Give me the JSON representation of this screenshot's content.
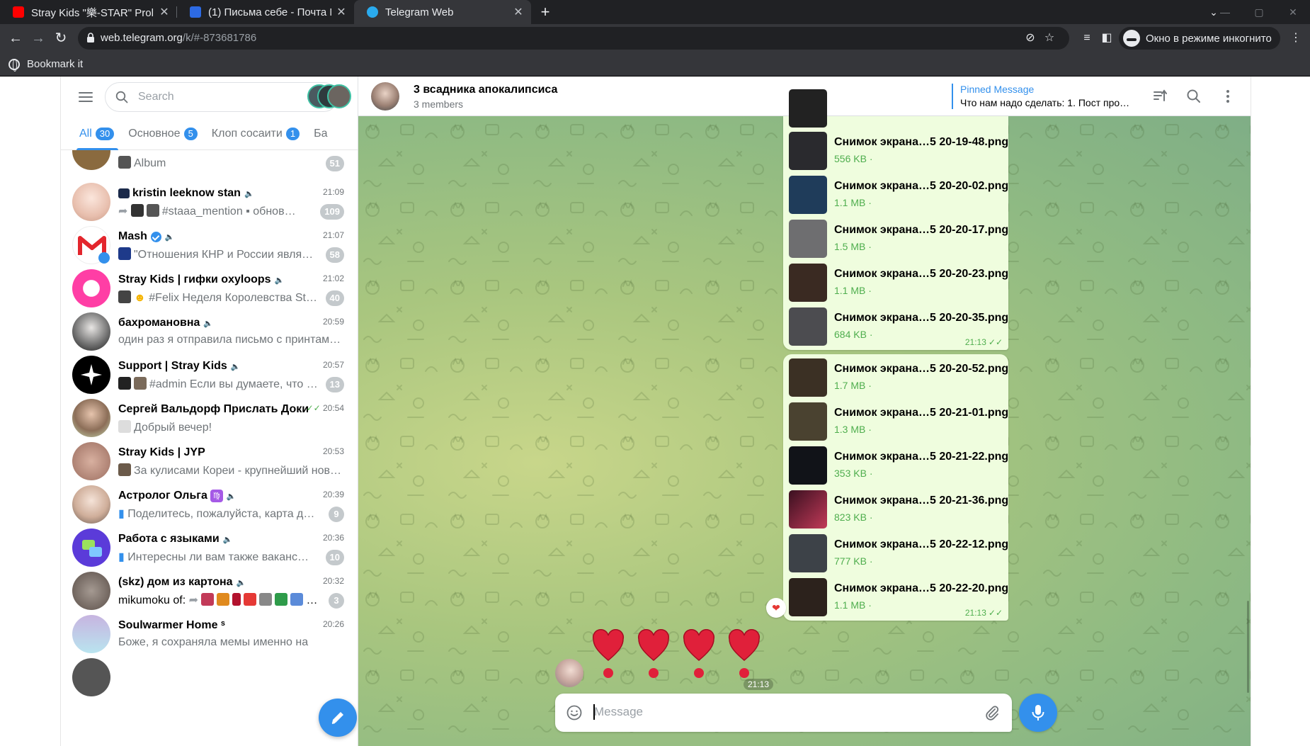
{
  "browser": {
    "tabs": [
      {
        "title": "Stray Kids \"樂-STAR\" Prol",
        "favicon_color": "#ff0000",
        "active": false
      },
      {
        "title": "(1) Письма себе - Почта M",
        "favicon_color": "#2d6ae3",
        "active": false
      },
      {
        "title": "Telegram Web",
        "favicon_color": "#2aabee",
        "active": true
      }
    ],
    "url_host": "web.telegram.org",
    "url_path": "/k/#-873681786",
    "incognito_label": "Окно в режиме инкогнито",
    "bookmark_label": "Bookmark it"
  },
  "sidebar": {
    "search_placeholder": "Search",
    "filter_tabs": [
      {
        "label": "All",
        "count": "30"
      },
      {
        "label": "Основное",
        "count": "5"
      },
      {
        "label": "Клоп сосаити",
        "count": "1"
      },
      {
        "label": "Ба",
        "count": ""
      }
    ],
    "chats": [
      {
        "name": "",
        "time": "",
        "message": "Album",
        "count": "51",
        "avatar": "#8a6a3f"
      },
      {
        "name": "kristin leeknow stan",
        "time": "21:09",
        "message": "#staaa_mention ▪ обнов…",
        "count": "109",
        "avatar": "#f2d2c9"
      },
      {
        "name": "Mash",
        "time": "21:07",
        "message": "\"Отношения КНР и России явля…",
        "count": "58",
        "avatar": "#ffffff"
      },
      {
        "name": "Stray Kids | гифки oxyloops",
        "time": "21:02",
        "message": "#Felix Неделя Королевства St…",
        "count": "40",
        "avatar": "#ff3ea5"
      },
      {
        "name": "бахромановна",
        "time": "20:59",
        "message": "один раз я отправила письмо с принтам…",
        "count": "",
        "avatar": "#3b3b3b"
      },
      {
        "name": "Support | Stray Kids",
        "time": "20:57",
        "message": "#admin Если вы думаете, что …",
        "count": "13",
        "avatar": "#000000"
      },
      {
        "name": "Сергей Вальдорф Прислать Доки",
        "time": "20:54",
        "message": "Добрый вечер!",
        "count": "",
        "avatar": "#8c7b6a"
      },
      {
        "name": "Stray Kids | JYP",
        "time": "20:53",
        "message": "За кулисами Кореи - крупнейший нов…",
        "count": "",
        "avatar": "#c9998a"
      },
      {
        "name": "Астролог Ольга",
        "time": "20:39",
        "message": "Поделитесь, пожалуйста, карта д…",
        "count": "9",
        "avatar": "#d9c2b4"
      },
      {
        "name": "Работа с языками",
        "time": "20:36",
        "message": "Интересны ли вам также ваканс…",
        "count": "10",
        "avatar": "#5b3bd9"
      },
      {
        "name": "(skz) дом из картона",
        "time": "20:32",
        "message": "mikumoku of:",
        "count": "3",
        "avatar": "#7c6b66"
      },
      {
        "name": "Soulwarmer Home ˢ",
        "time": "20:26",
        "message": "Боже, я сохраняла мемы именно на",
        "count": "",
        "avatar": "#b9e4ef"
      }
    ]
  },
  "chat": {
    "title": "3 всадника апокалипсиса",
    "subtitle": "3 members",
    "pinned_title": "Pinned Message",
    "pinned_text": "Что нам надо сделать: 1. Пост про…",
    "groups": [
      {
        "time": "21:13",
        "files": [
          {
            "name": "Снимок экрана…5 20-19-48.png",
            "size": "556 KB ·",
            "thumb": "#2a2a2e"
          },
          {
            "name": "Снимок экрана…5 20-20-02.png",
            "size": "1.1 MB ·",
            "thumb": "#1f3c5a"
          },
          {
            "name": "Снимок экрана…5 20-20-17.png",
            "size": "1.5 MB ·",
            "thumb": "#6e6e70"
          },
          {
            "name": "Снимок экрана…5 20-20-23.png",
            "size": "1.1 MB ·",
            "thumb": "#3a2a22"
          },
          {
            "name": "Снимок экрана…5 20-20-35.png",
            "size": "684 KB ·",
            "thumb": "#4c4c50"
          }
        ]
      },
      {
        "time": "21:13",
        "files": [
          {
            "name": "Снимок экрана…5 20-20-52.png",
            "size": "1.7 MB ·",
            "thumb": "#3b3024"
          },
          {
            "name": "Снимок экрана…5 20-21-01.png",
            "size": "1.3 MB ·",
            "thumb": "#4a4230"
          },
          {
            "name": "Снимок экрана…5 20-21-22.png",
            "size": "353 KB ·",
            "thumb": "#111318"
          },
          {
            "name": "Снимок экрана…5 20-21-36.png",
            "size": "823 KB ·",
            "thumb": "#c23a58"
          },
          {
            "name": "Снимок экрана…5 20-22-12.png",
            "size": "777 KB ·",
            "thumb": "#3d4248"
          },
          {
            "name": "Снимок экрана…5 20-22-20.png",
            "size": "1.1 MB ·",
            "thumb": "#2c221c"
          }
        ]
      }
    ],
    "reaction": "❤",
    "hearts_time": "21:13",
    "composer_placeholder": "Message"
  }
}
